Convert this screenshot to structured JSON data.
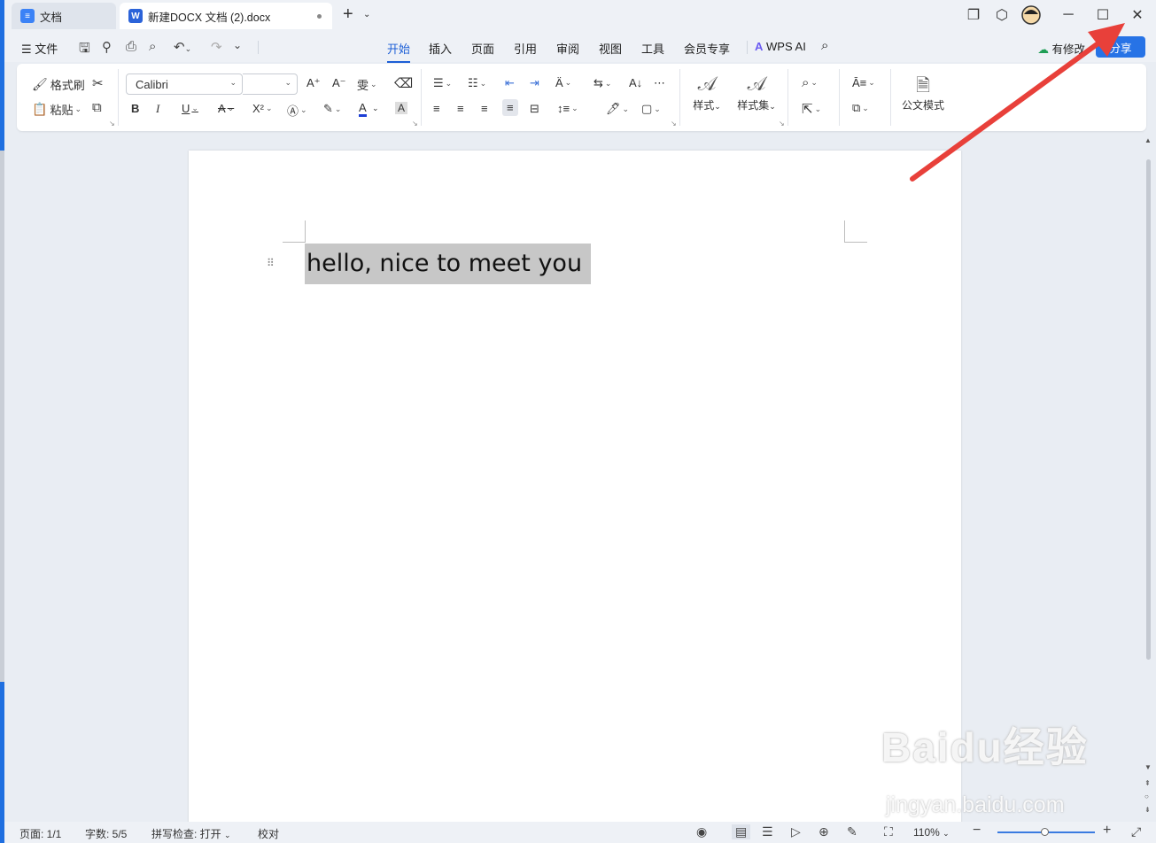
{
  "tabs": [
    {
      "label": "文档",
      "icon": "docs-home-icon"
    },
    {
      "label": "新建DOCX 文档 (2).docx",
      "icon": "word-doc-icon",
      "badge": "W"
    }
  ],
  "menu": {
    "file_label": "文件",
    "tabs": [
      "开始",
      "插入",
      "页面",
      "引用",
      "审阅",
      "视图",
      "工具",
      "会员专享"
    ],
    "active_tab": "开始",
    "wps_ai": "WPS AI",
    "modified_label": "有修改",
    "share_label": "分享"
  },
  "ribbon": {
    "format_painter": "格式刷",
    "paste": "粘贴",
    "font_name": "Calibri",
    "font_size": "",
    "styles": "样式",
    "style_set": "样式集",
    "official_mode": "公文模式"
  },
  "document": {
    "selected_text": "hello, nice to meet you"
  },
  "status": {
    "page": "页面: 1/1",
    "word_count": "字数: 5/5",
    "spell_check": "拼写检查: 打开",
    "proofread": "校对",
    "zoom": "110%"
  },
  "watermark": {
    "brand": "Baidu经验",
    "url": "jingyan.baidu.com"
  },
  "colors": {
    "accent": "#1d5fd6",
    "share_button": "#2773e6",
    "annotation_arrow": "#e8403a",
    "selection_highlight": "#c7c7c7"
  }
}
